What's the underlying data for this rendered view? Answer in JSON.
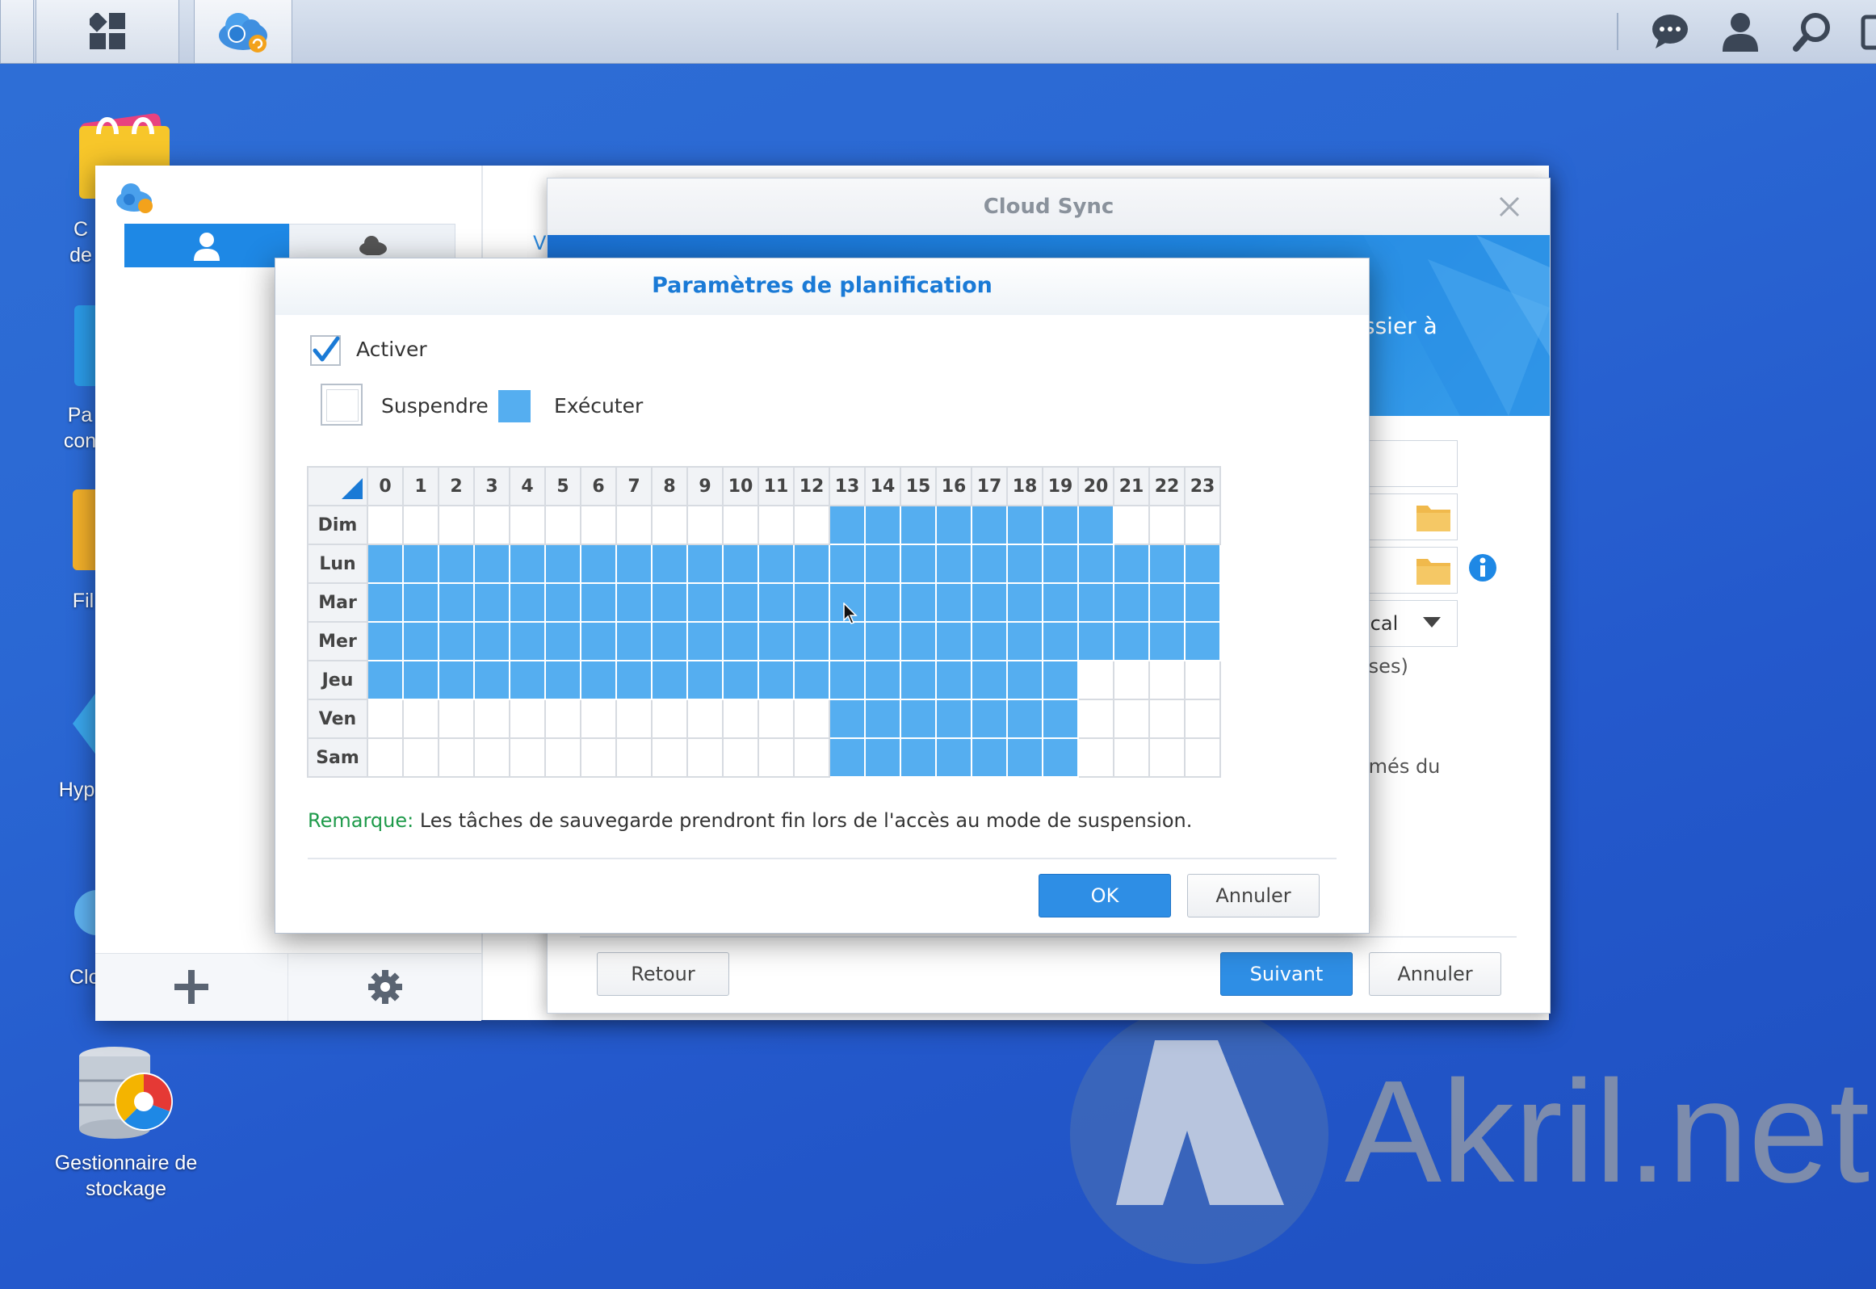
{
  "desktop": {
    "icons": [
      {
        "label": "C\nde"
      },
      {
        "label": "Pa\ncon"
      },
      {
        "label": "Fil"
      },
      {
        "label": "Hyp"
      },
      {
        "label": "Clo"
      },
      {
        "label": "Gestionnaire de\nstockage"
      }
    ],
    "watermark": "Akril.net"
  },
  "taskbar": {
    "main_menu_icon": "grid-icon",
    "app_icon": "cloud-sync-icon",
    "right_icons": [
      "chat-icon",
      "user-icon",
      "search-icon",
      "widgets-icon"
    ]
  },
  "wizard": {
    "title": "Cloud Sync",
    "banner_partial_1": "ssier à",
    "field_partial_local": "ocal",
    "partial_text_1": "ises)",
    "partial_text_2": "imés du",
    "back_label": "Retour",
    "next_label": "Suivant",
    "cancel_label": "Annuler"
  },
  "app_window": {
    "sidebar_partial": "V"
  },
  "dialog": {
    "title": "Paramètres de planification",
    "enable_label": "Activer",
    "enable_checked": true,
    "legend_suspend": "Suspendre",
    "legend_run": "Exécuter",
    "hours": [
      "0",
      "1",
      "2",
      "3",
      "4",
      "5",
      "6",
      "7",
      "8",
      "9",
      "10",
      "11",
      "12",
      "13",
      "14",
      "15",
      "16",
      "17",
      "18",
      "19",
      "20",
      "21",
      "22",
      "23"
    ],
    "days": [
      "Dim",
      "Lun",
      "Mar",
      "Mer",
      "Jeu",
      "Ven",
      "Sam"
    ],
    "schedule": [
      [
        0,
        0,
        0,
        0,
        0,
        0,
        0,
        0,
        0,
        0,
        0,
        0,
        0,
        1,
        1,
        1,
        1,
        1,
        1,
        1,
        1,
        0,
        0,
        0
      ],
      [
        1,
        1,
        1,
        1,
        1,
        1,
        1,
        1,
        1,
        1,
        1,
        1,
        1,
        1,
        1,
        1,
        1,
        1,
        1,
        1,
        1,
        1,
        1,
        1
      ],
      [
        1,
        1,
        1,
        1,
        1,
        1,
        1,
        1,
        1,
        1,
        1,
        1,
        1,
        1,
        1,
        1,
        1,
        1,
        1,
        1,
        1,
        1,
        1,
        1
      ],
      [
        1,
        1,
        1,
        1,
        1,
        1,
        1,
        1,
        1,
        1,
        1,
        1,
        1,
        1,
        1,
        1,
        1,
        1,
        1,
        1,
        1,
        1,
        1,
        1
      ],
      [
        1,
        1,
        1,
        1,
        1,
        1,
        1,
        1,
        1,
        1,
        1,
        1,
        1,
        1,
        1,
        1,
        1,
        1,
        1,
        1,
        0,
        0,
        0,
        0
      ],
      [
        0,
        0,
        0,
        0,
        0,
        0,
        0,
        0,
        0,
        0,
        0,
        0,
        0,
        1,
        1,
        1,
        1,
        1,
        1,
        1,
        0,
        0,
        0,
        0
      ],
      [
        0,
        0,
        0,
        0,
        0,
        0,
        0,
        0,
        0,
        0,
        0,
        0,
        0,
        1,
        1,
        1,
        1,
        1,
        1,
        1,
        0,
        0,
        0,
        0
      ]
    ],
    "note_label": "Remarque:",
    "note_text": "Les tâches de sauvegarde prendront fin lors de l'accès au mode de suspension.",
    "ok_label": "OK",
    "cancel_label": "Annuler"
  },
  "colors": {
    "accent": "#1a7ad6",
    "run_cell": "#55aef0",
    "note_green": "#1e9a4a"
  }
}
